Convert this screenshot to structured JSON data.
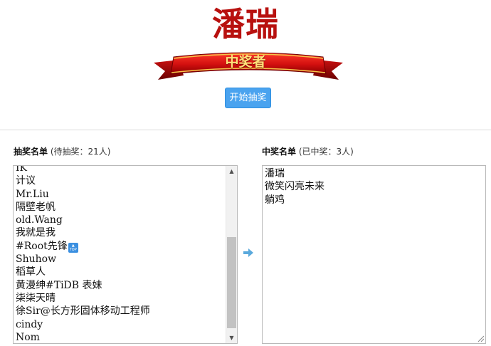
{
  "winner_display": {
    "name": "潘瑞"
  },
  "banner": {
    "text": "中奖者"
  },
  "start_button": {
    "label": "开始抽奖"
  },
  "candidates": {
    "title": "抽奖名单",
    "count_text": "(待抽奖：21人)",
    "items": [
      "IK",
      "计议",
      "Mr.Liu",
      "隔壁老帆",
      "old.Wang",
      "我就是我",
      "#Root先锋",
      "Shuhow",
      "稻草人",
      "黄漫绅#TiDB 表妹",
      "柒柒天晴",
      "徐Sir@长方形固体移动工程师",
      "cindy",
      "Nom"
    ],
    "top_badge_text": "TOP",
    "scroll_fraction": 0.6
  },
  "winners": {
    "title": "中奖名单",
    "count_text": "(已中奖：3人)",
    "items": [
      "潘瑞",
      "微笑闪亮未来",
      "躺鸡"
    ]
  },
  "colors": {
    "title_red": "#b8110f",
    "button_blue": "#4aa3ef",
    "arrow_blue": "#5aa9dc"
  },
  "icons": {
    "transfer_arrow": "arrow-right-icon",
    "ribbon": "ribbon-banner-icon"
  }
}
